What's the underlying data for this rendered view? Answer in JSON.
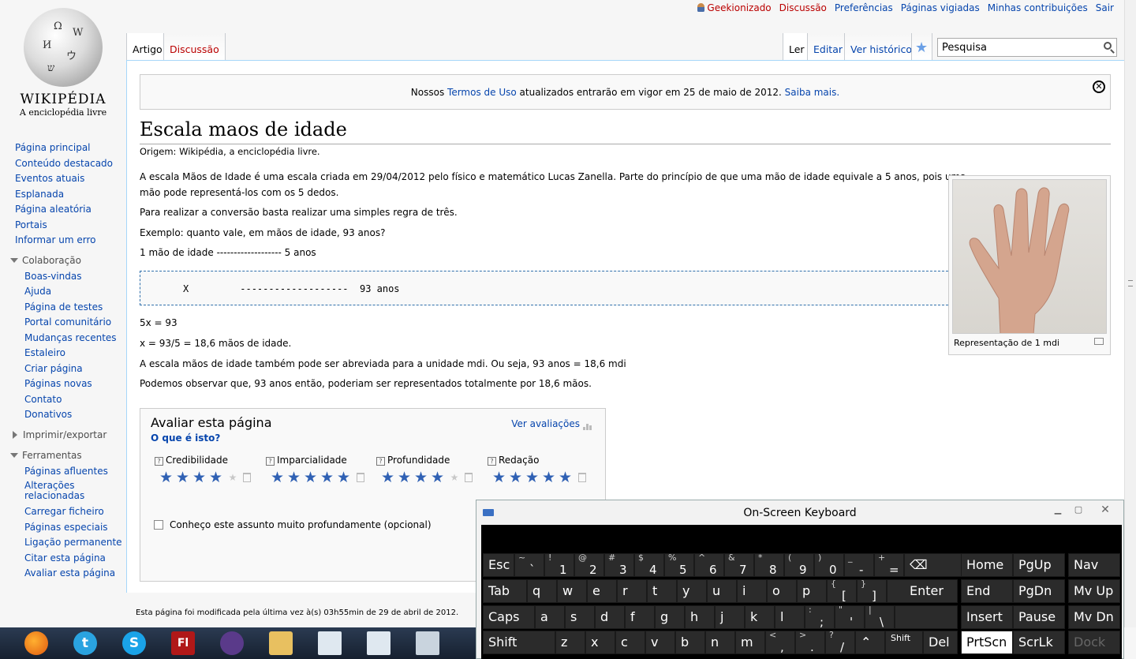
{
  "personal": {
    "user": "Geekionizado",
    "talk": "Discussão",
    "prefs": "Preferências",
    "watchlist": "Páginas vigiadas",
    "contribs": "Minhas contribuições",
    "logout": "Sair"
  },
  "logo": {
    "wordmark": "WIKIPÉDIA",
    "tagline": "A enciclopédia livre"
  },
  "nav": {
    "main": [
      "Página principal",
      "Conteúdo destacado",
      "Eventos atuais",
      "Esplanada",
      "Página aleatória",
      "Portais",
      "Informar um erro"
    ],
    "colab_heading": "Colaboração",
    "colab": [
      "Boas-vindas",
      "Ajuda",
      "Página de testes",
      "Portal comunitário",
      "Mudanças recentes",
      "Estaleiro",
      "Criar página",
      "Páginas novas",
      "Contato",
      "Donativos"
    ],
    "print_heading": "Imprimir/exportar",
    "tools_heading": "Ferramentas",
    "tools": [
      "Páginas afluentes",
      "Alterações relacionadas",
      "Carregar ficheiro",
      "Páginas especiais",
      "Ligação permanente",
      "Citar esta página",
      "Avaliar esta página"
    ]
  },
  "tabs": {
    "article": "Artigo",
    "discussion": "Discussão",
    "read": "Ler",
    "edit": "Editar",
    "history": "Ver histórico"
  },
  "search": {
    "value": "Pesquisa"
  },
  "notice": {
    "pre": "Nossos ",
    "link": "Termos de Uso",
    "mid": " atualizados entrarão em vigor em 25 de maio de 2012. ",
    "more": "Saiba mais."
  },
  "article": {
    "title": "Escala maos de idade",
    "sitesub": "Origem: Wikipédia, a enciclopédia livre.",
    "p1a": "A escala Mãos de Idade é uma escala criada em 29/04/2012 pelo físico e matemático Lucas Zanella. Parte do princípio de que uma mão de idade equivale a 5 anos, pois uma",
    "p1b": "mão pode representá-los com os 5 dedos.",
    "p2": "Para realizar a conversão basta realizar uma simples regra de três.",
    "p3": "Exemplo: quanto vale, em mãos de idade, 93 anos?",
    "p4": "1 mão de idade ------------------- 5 anos",
    "pre": "X         -------------------  93 anos",
    "p5": "5x = 93",
    "p6": "x = 93/5 = 18,6 mãos de idade.",
    "p7": "A escala mãos de idade também pode ser abreviada para a unidade mdi. Ou seja, 93 anos = 18,6 mdi",
    "p8": "Podemos observar que, 93 anos então, poderiam ser representados totalmente por 18,6 mãos.",
    "caption": "Representação de 1 mdi"
  },
  "rating": {
    "heading": "Avaliar esta página",
    "what": "O que é isto?",
    "view": "Ver avaliações",
    "criteria": [
      {
        "label": "Credibilidade",
        "stars": 4
      },
      {
        "label": "Imparcialidade",
        "stars": 5
      },
      {
        "label": "Profundidade",
        "stars": 4
      },
      {
        "label": "Redação",
        "stars": 5
      }
    ],
    "knows": "Conheço este assunto muito profundamente (opcional)"
  },
  "footer": {
    "modified": "Esta página foi modificada pela última vez à(s) 03h55min de 29 de abril de 2012."
  },
  "osk": {
    "title": "On-Screen Keyboard",
    "keys": {
      "esc": "Esc",
      "tab": "Tab",
      "caps": "Caps",
      "shift": "Shift",
      "enter": "Enter",
      "del": "Del",
      "shift2": "Shift",
      "home": "Home",
      "pgup": "PgUp",
      "nav": "Nav",
      "end": "End",
      "pgdn": "PgDn",
      "mvup": "Mv Up",
      "insert": "Insert",
      "pause": "Pause",
      "mvdn": "Mv Dn",
      "prtscn": "PrtScn",
      "scrlk": "ScrLk",
      "dock": "Dock"
    }
  },
  "colors": {
    "link": "#0645ad",
    "redlink": "#ba0000",
    "star": "#3061b4"
  }
}
